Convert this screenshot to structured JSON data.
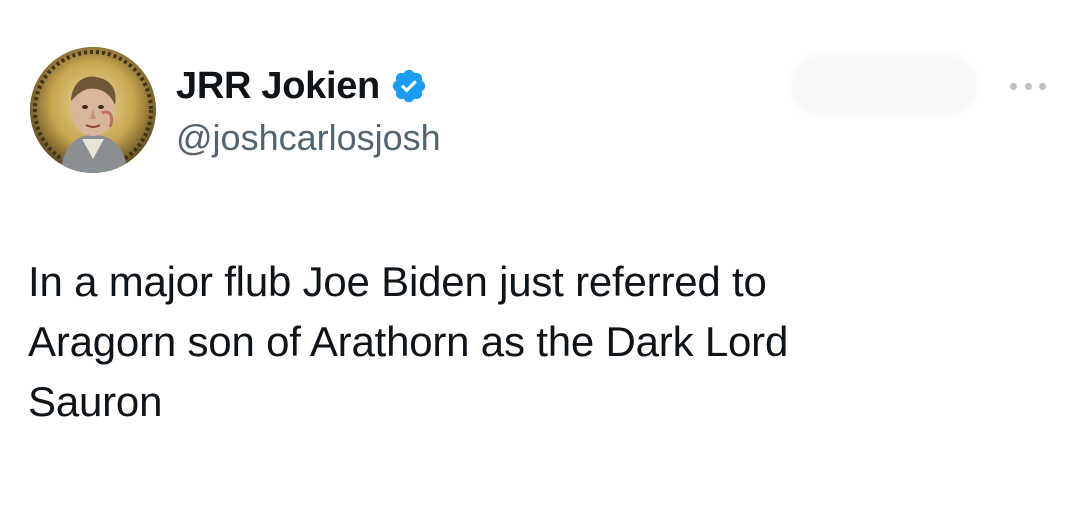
{
  "author": {
    "display_name": "JRR Jokien",
    "handle": "@joshcarlosjosh",
    "verified": true,
    "avatar_icon": "avatar-portrait-icon",
    "verified_icon": "verified-badge-icon",
    "verified_color": "#1d9bf0"
  },
  "actions": {
    "follow_label": "",
    "more_icon": "more-dots-icon"
  },
  "tweet": {
    "lines": [
      "In a major flub Joe Biden just referred to",
      "Aragorn son of Arathorn as the Dark Lord",
      "Sauron"
    ]
  }
}
